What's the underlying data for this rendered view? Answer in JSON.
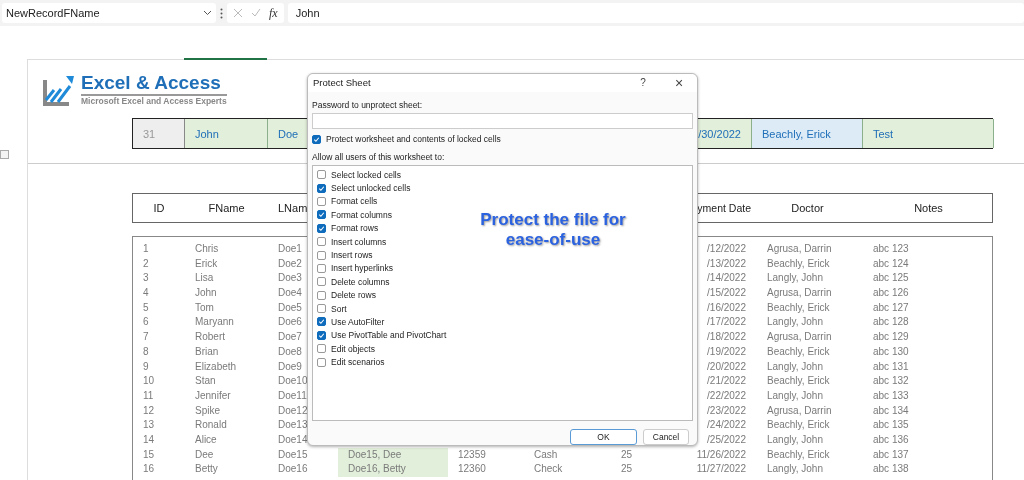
{
  "formula_bar": {
    "name_box": "NewRecordFName",
    "fx_label": "fx",
    "formula": "John"
  },
  "logo": {
    "title": "Excel & Access",
    "subtitle": "Microsoft Excel and Access Experts"
  },
  "new_record": [
    {
      "text": "31",
      "kind": "id"
    },
    {
      "text": "John",
      "kind": "entry"
    },
    {
      "text": "Doe",
      "kind": "entry"
    },
    {
      "text": "/30/2022",
      "kind": "date"
    },
    {
      "text": "Beachly, Erick",
      "kind": "lookup"
    },
    {
      "text": "Test",
      "kind": "entry"
    }
  ],
  "table": {
    "columns": [
      "ID",
      "FName",
      "LNam",
      "yment Date",
      "Doctor",
      "Notes"
    ],
    "rows": [
      {
        "id": "1",
        "fname": "Chris",
        "lname": "Doe1",
        "date": "/12/2022",
        "doctor": "Agrusa, Darrin",
        "notes": "abc 123"
      },
      {
        "id": "2",
        "fname": "Erick",
        "lname": "Doe2",
        "date": "/13/2022",
        "doctor": "Beachly, Erick",
        "notes": "abc 124"
      },
      {
        "id": "3",
        "fname": "Lisa",
        "lname": "Doe3",
        "date": "/14/2022",
        "doctor": "Langly, John",
        "notes": "abc 125"
      },
      {
        "id": "4",
        "fname": "John",
        "lname": "Doe4",
        "date": "/15/2022",
        "doctor": "Agrusa, Darrin",
        "notes": "abc 126"
      },
      {
        "id": "5",
        "fname": "Tom",
        "lname": "Doe5",
        "date": "/16/2022",
        "doctor": "Beachly, Erick",
        "notes": "abc 127"
      },
      {
        "id": "6",
        "fname": "Maryann",
        "lname": "Doe6",
        "date": "/17/2022",
        "doctor": "Langly, John",
        "notes": "abc 128"
      },
      {
        "id": "7",
        "fname": "Robert",
        "lname": "Doe7",
        "date": "/18/2022",
        "doctor": "Agrusa, Darrin",
        "notes": "abc 129"
      },
      {
        "id": "8",
        "fname": "Brian",
        "lname": "Doe8",
        "date": "/19/2022",
        "doctor": "Beachly, Erick",
        "notes": "abc 130"
      },
      {
        "id": "9",
        "fname": "Elizabeth",
        "lname": "Doe9",
        "date": "/20/2022",
        "doctor": "Langly, John",
        "notes": "abc 131"
      },
      {
        "id": "10",
        "fname": "Stan",
        "lname": "Doe10",
        "date": "/21/2022",
        "doctor": "Beachly, Erick",
        "notes": "abc 132"
      },
      {
        "id": "11",
        "fname": "Jennifer",
        "lname": "Doe11",
        "date": "/22/2022",
        "doctor": "Langly, John",
        "notes": "abc 133"
      },
      {
        "id": "12",
        "fname": "Spike",
        "lname": "Doe12",
        "date": "/23/2022",
        "doctor": "Agrusa, Darrin",
        "notes": "abc 134"
      },
      {
        "id": "13",
        "fname": "Ronald",
        "lname": "Doe13",
        "date": "/24/2022",
        "doctor": "Beachly, Erick",
        "notes": "abc 135"
      },
      {
        "id": "14",
        "fname": "Alice",
        "lname": "Doe14",
        "date": "/25/2022",
        "doctor": "Langly, John",
        "notes": "abc 136"
      },
      {
        "id": "15",
        "fname": "Dee",
        "lname": "Doe15",
        "full_name": "Doe15, Dee",
        "account": "12359",
        "payment": "Cash",
        "amount": "25",
        "date": "11/26/2022",
        "doctor": "Beachly, Erick",
        "notes": "abc 137"
      },
      {
        "id": "16",
        "fname": "Betty",
        "lname": "Doe16",
        "full_name": "Doe16, Betty",
        "account": "12360",
        "payment": "Check",
        "amount": "25",
        "date": "11/27/2022",
        "doctor": "Langly, John",
        "notes": "abc 138"
      }
    ]
  },
  "dialog": {
    "title": "Protect Sheet",
    "help": "?",
    "close": "×",
    "password_label": "Password to unprotect sheet:",
    "protect": {
      "label": "Protect worksheet and contents of locked cells",
      "checked": true
    },
    "allow_label": "Allow all users of this worksheet to:",
    "options": [
      {
        "label": "Select locked cells",
        "checked": false
      },
      {
        "label": "Select unlocked cells",
        "checked": true
      },
      {
        "label": "Format cells",
        "checked": false
      },
      {
        "label": "Format columns",
        "checked": true
      },
      {
        "label": "Format rows",
        "checked": true
      },
      {
        "label": "Insert columns",
        "checked": false
      },
      {
        "label": "Insert rows",
        "checked": false
      },
      {
        "label": "Insert hyperlinks",
        "checked": false
      },
      {
        "label": "Delete columns",
        "checked": false
      },
      {
        "label": "Delete rows",
        "checked": false
      },
      {
        "label": "Sort",
        "checked": false
      },
      {
        "label": "Use AutoFilter",
        "checked": true
      },
      {
        "label": "Use PivotTable and PivotChart",
        "checked": true
      },
      {
        "label": "Edit objects",
        "checked": false
      },
      {
        "label": "Edit scenarios",
        "checked": false
      }
    ],
    "buttons": [
      "OK",
      "Cancel"
    ]
  },
  "caption": [
    "Protect the file for",
    "ease-of-use"
  ]
}
